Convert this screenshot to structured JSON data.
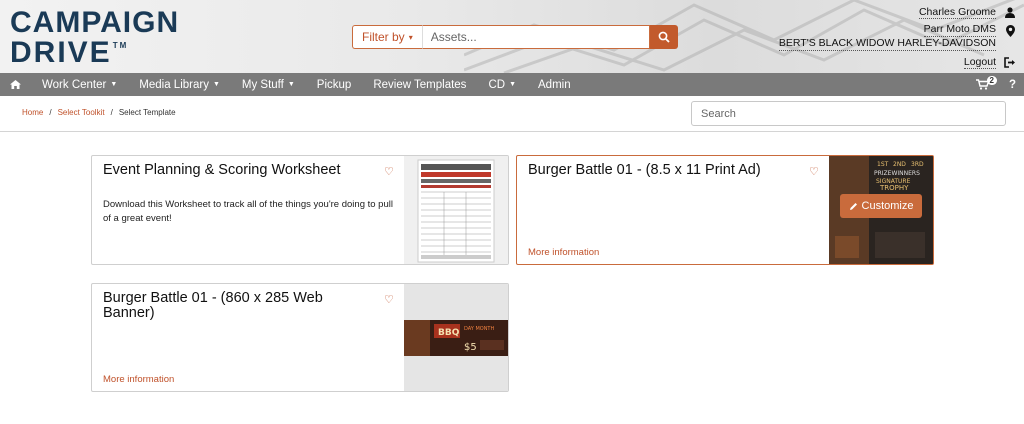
{
  "brand": {
    "line1": "CAMPAIGN",
    "line2": "DRIVE",
    "tm": "TM",
    "accent": "#1a3a56"
  },
  "search": {
    "filter_label": "Filter by",
    "placeholder": "Assets...",
    "icon": "search-icon"
  },
  "user": {
    "name": "Charles Groome",
    "dms": "Parr Moto DMS",
    "dealer": "BERT'S BLACK WIDOW HARLEY-DAVIDSON",
    "logout": "Logout"
  },
  "nav": {
    "home_icon": "home-icon",
    "items": [
      {
        "label": "Work Center"
      },
      {
        "label": "Media Library"
      },
      {
        "label": "My Stuff"
      },
      {
        "label": "Pickup"
      },
      {
        "label": "Review Templates"
      },
      {
        "label": "CD"
      },
      {
        "label": "Admin"
      }
    ],
    "cart_count": "2",
    "help": "?"
  },
  "breadcrumb": {
    "items": [
      "Home",
      "Select Toolkit",
      "Select Template"
    ],
    "separator": "/"
  },
  "page_search": {
    "placeholder": "Search"
  },
  "cards": [
    {
      "title": "Event Planning & Scoring Worksheet",
      "description": "Download this Worksheet to track all of the things you're doing to pull of a great event!",
      "thumb_header": "EVENT PLANNING & SCORING WORKSHEET"
    },
    {
      "title": "Burger Battle 01 - (8.5 x 11 Print Ad)",
      "more": "More information",
      "customize": "Customize",
      "thumb_text": [
        "1ST",
        "2ND",
        "3RD",
        "PRIZEWINNERS",
        "SIGNATURE",
        "TROPHY"
      ]
    },
    {
      "title": "Burger Battle 01 - (860 x 285 Web Banner)",
      "more": "More information",
      "thumb_text": [
        "BBQ",
        "DAY MONTH",
        "$5"
      ]
    }
  ],
  "colors": {
    "accent": "#c0522b",
    "nav_bg": "#7a7a7a"
  }
}
